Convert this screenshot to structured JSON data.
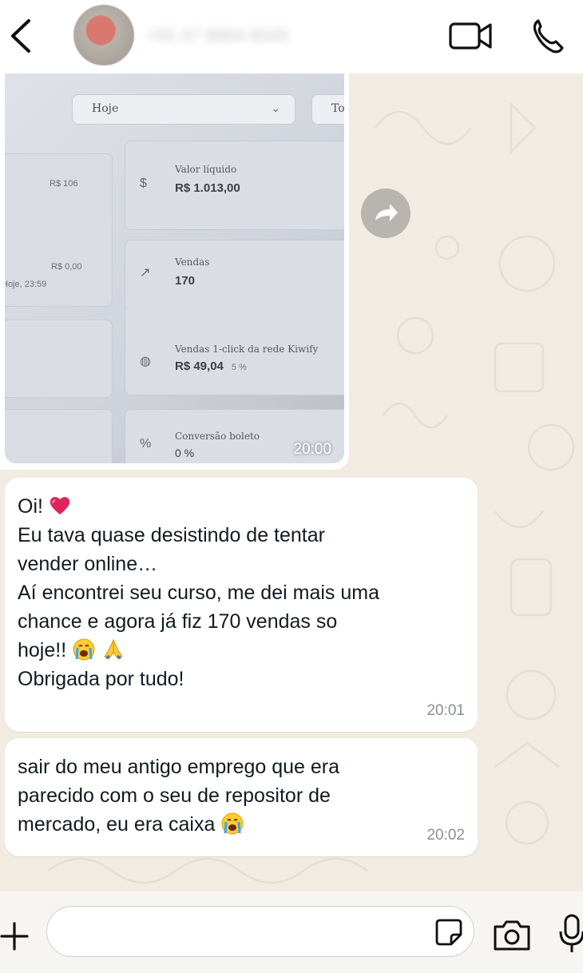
{
  "header": {
    "contact_name": "+55 47 9884-9545",
    "icons": [
      "back-arrow-icon",
      "video-call-icon",
      "phone-call-icon"
    ]
  },
  "image_message": {
    "time": "20:00",
    "photo_text": {
      "dropdown": "Hoje",
      "dropdown2": "To",
      "left_value_1": "R$ 106",
      "left_value_2": "R$ 0,00",
      "left_sub": "Hoje, 23:59",
      "card1_label": "Valor líquido",
      "card1_value": "R$ 1.013,00",
      "card2_label": "Vendas",
      "card2_value": "170",
      "card3_label": "Vendas 1-click da rede Kiwify",
      "card3_value": "R$ 49,04",
      "card3_pct": "5 %",
      "card4_label": "Conversão boleto",
      "card4_value": "0 %"
    }
  },
  "messages": [
    {
      "lines": [
        "Oi!",
        "Eu tava quase desistindo de tentar",
        "vender online…",
        "Aí encontrei seu curso, me dei mais uma",
        "chance e agora já fiz 170 vendas so",
        "hoje!!",
        "Obrigada por tudo!"
      ],
      "time": "20:01"
    },
    {
      "lines": [
        "sair do meu antigo emprego que era",
        "parecido com o seu de repositor de",
        "mercado, eu era caixa"
      ],
      "time": "20:02"
    }
  ],
  "colors": {
    "chat_background": "#f1ebe2",
    "bubble": "#ffffff",
    "timestamp": "#8a8f94",
    "heart": "#e0245e"
  }
}
